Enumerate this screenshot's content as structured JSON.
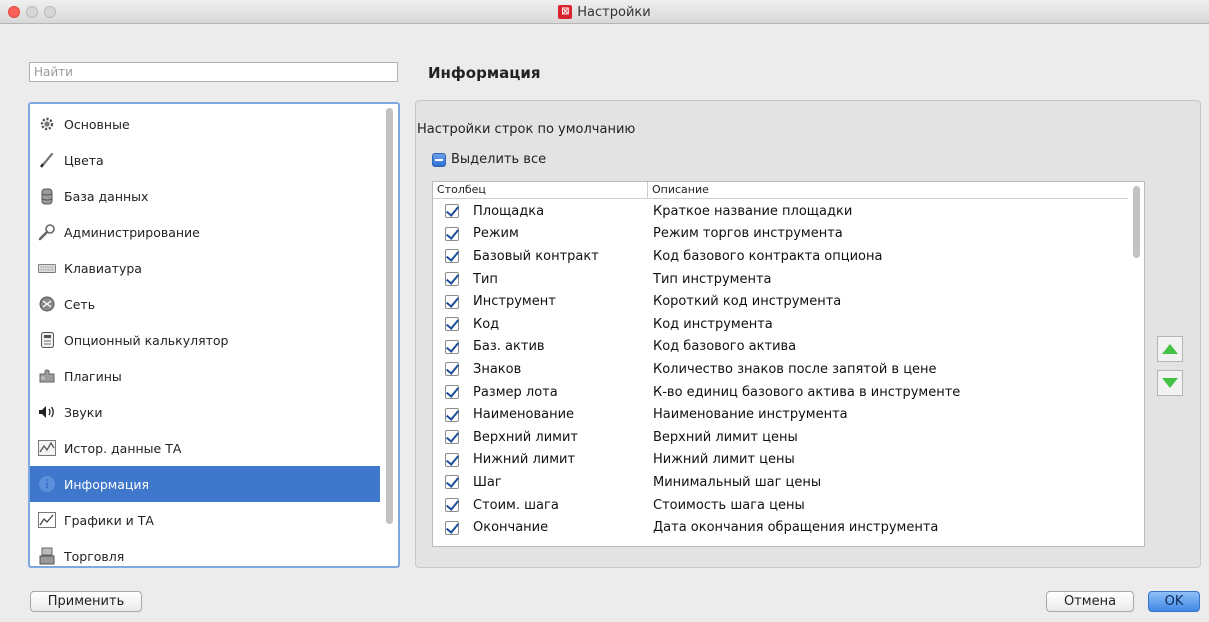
{
  "window": {
    "title": "Настройки"
  },
  "search": {
    "placeholder": "Найти",
    "value": ""
  },
  "sidebar": {
    "items": [
      {
        "label": "Основные",
        "icon": "gear-icon",
        "selected": false
      },
      {
        "label": "Цвета",
        "icon": "brush-icon",
        "selected": false
      },
      {
        "label": "База данных",
        "icon": "database-icon",
        "selected": false
      },
      {
        "label": "Администрирование",
        "icon": "wrench-icon",
        "selected": false
      },
      {
        "label": "Клавиатура",
        "icon": "keyboard-icon",
        "selected": false
      },
      {
        "label": "Сеть",
        "icon": "network-icon",
        "selected": false
      },
      {
        "label": "Опционный калькулятор",
        "icon": "calculator-icon",
        "selected": false
      },
      {
        "label": "Плагины",
        "icon": "puzzle-icon",
        "selected": false
      },
      {
        "label": "Звуки",
        "icon": "speaker-icon",
        "selected": false
      },
      {
        "label": "Истор. данные ТА",
        "icon": "history-chart-icon",
        "selected": false
      },
      {
        "label": "Информация",
        "icon": "info-icon",
        "selected": true
      },
      {
        "label": "Графики и ТА",
        "icon": "line-chart-icon",
        "selected": false
      },
      {
        "label": "Торговля",
        "icon": "trade-icon",
        "selected": false
      }
    ]
  },
  "main": {
    "heading": "Информация",
    "section_label": "Настройки строк по умолчанию",
    "select_all_label": "Выделить все",
    "table": {
      "columns": [
        "Столбец",
        "Описание"
      ],
      "rows": [
        {
          "name": "Площадка",
          "desc": "Краткое название площадки",
          "checked": true
        },
        {
          "name": "Режим",
          "desc": "Режим торгов инструмента",
          "checked": true
        },
        {
          "name": "Базовый контракт",
          "desc": "Код базового контракта опциона",
          "checked": true
        },
        {
          "name": "Тип",
          "desc": "Тип инструмента",
          "checked": true
        },
        {
          "name": "Инструмент",
          "desc": "Короткий код инструмента",
          "checked": true
        },
        {
          "name": "Код",
          "desc": "Код инструмента",
          "checked": true
        },
        {
          "name": "Баз. актив",
          "desc": "Код базового актива",
          "checked": true
        },
        {
          "name": "Знаков",
          "desc": "Количество знаков после запятой в цене",
          "checked": true
        },
        {
          "name": "Размер лота",
          "desc": "К-во единиц базового актива в инструменте",
          "checked": true
        },
        {
          "name": "Наименование",
          "desc": "Наименование инструмента",
          "checked": true
        },
        {
          "name": "Верхний лимит",
          "desc": "Верхний лимит цены",
          "checked": true
        },
        {
          "name": "Нижний лимит",
          "desc": "Нижний лимит цены",
          "checked": true
        },
        {
          "name": "Шаг",
          "desc": "Минимальный шаг цены",
          "checked": true
        },
        {
          "name": "Стоим. шага",
          "desc": "Стоимость шага цены",
          "checked": true
        },
        {
          "name": "Окончание",
          "desc": "Дата окончания обращения инструмента",
          "checked": true
        }
      ]
    },
    "move_up_icon": "arrow-up-icon",
    "move_down_icon": "arrow-down-icon"
  },
  "footer": {
    "apply_label": "Применить",
    "cancel_label": "Отмена",
    "ok_label": "OK"
  },
  "colors": {
    "selection": "#3e77cc",
    "ok_button": "#3f87e6",
    "move_arrows": "#45c245",
    "sidebar_focus_border": "#7fa9de"
  }
}
